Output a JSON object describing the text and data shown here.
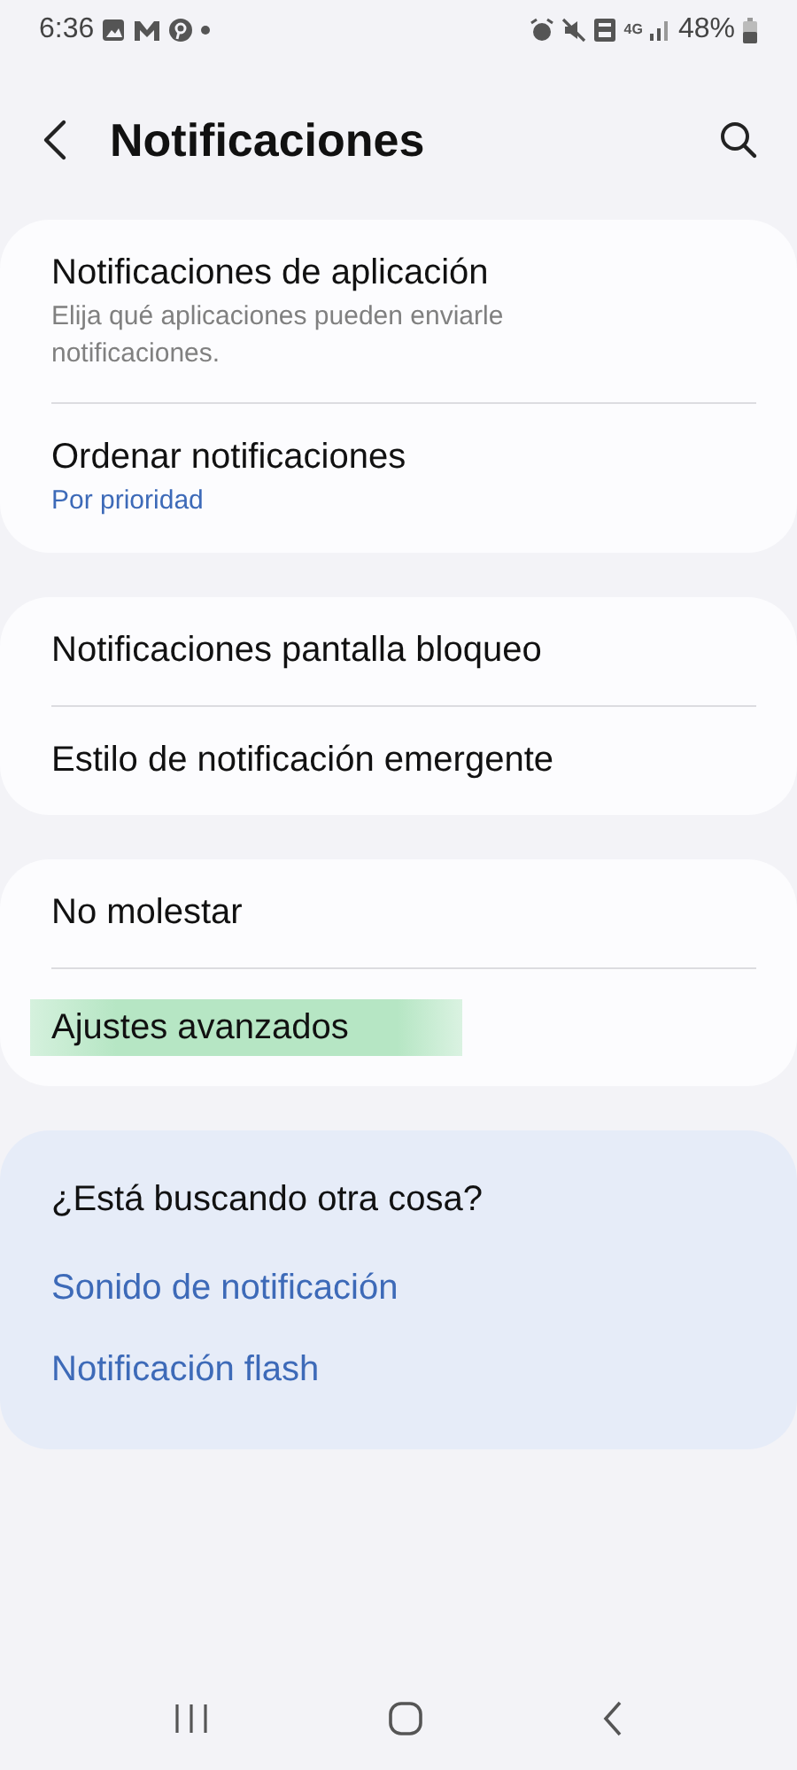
{
  "status_bar": {
    "time": "6:36",
    "network_type": "4G",
    "battery": "48%"
  },
  "header": {
    "title": "Notificaciones"
  },
  "groups": [
    {
      "items": [
        {
          "title": "Notificaciones de aplicación",
          "subtitle": {
            "text": "Elija qué aplicaciones pueden enviarle notificaciones.",
            "kind": "description"
          },
          "highlighted": false
        },
        {
          "title": "Ordenar notificaciones",
          "subtitle": {
            "text": "Por prioridad",
            "kind": "value"
          },
          "highlighted": false
        }
      ]
    },
    {
      "items": [
        {
          "title": "Notificaciones pantalla bloqueo",
          "highlighted": false
        },
        {
          "title": "Estilo de notificación emergente",
          "highlighted": false
        }
      ]
    },
    {
      "items": [
        {
          "title": "No molestar",
          "highlighted": false
        },
        {
          "title": "Ajustes avanzados",
          "highlighted": true
        }
      ]
    }
  ],
  "suggestions": {
    "title": "¿Está buscando otra cosa?",
    "links": [
      "Sonido de notificación",
      "Notificación flash"
    ]
  }
}
